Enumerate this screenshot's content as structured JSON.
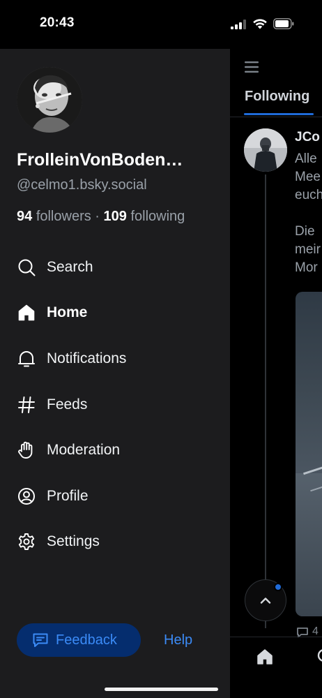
{
  "status_bar": {
    "time": "20:43"
  },
  "main": {
    "tabs": [
      {
        "label": "Following"
      }
    ],
    "post": {
      "author": "JCo",
      "text_lines": [
        "Alle",
        "Mee",
        "euch",
        "",
        "Die",
        "meir",
        "Mor"
      ],
      "reply_count": "4"
    }
  },
  "drawer": {
    "profile": {
      "display_name": "FrolleinVonBoden…",
      "handle": "@celmo1.bsky.social",
      "followers_count": "94",
      "followers_label": "followers",
      "separator": "·",
      "following_count": "109",
      "following_label": "following"
    },
    "nav_items": [
      {
        "label": "Search",
        "icon": "search-icon"
      },
      {
        "label": "Home",
        "icon": "home-icon",
        "active": true
      },
      {
        "label": "Notifications",
        "icon": "bell-icon"
      },
      {
        "label": "Feeds",
        "icon": "hash-icon"
      },
      {
        "label": "Moderation",
        "icon": "hand-icon"
      },
      {
        "label": "Profile",
        "icon": "user-circle-icon"
      },
      {
        "label": "Settings",
        "icon": "gear-icon"
      }
    ],
    "feedback_label": "Feedback",
    "help_label": "Help"
  },
  "colors": {
    "drawer_bg": "#1c1c1e",
    "accent": "#3b8bf7",
    "feedback_bg": "#052d6e",
    "tab_underline": "#1f6bd8"
  }
}
